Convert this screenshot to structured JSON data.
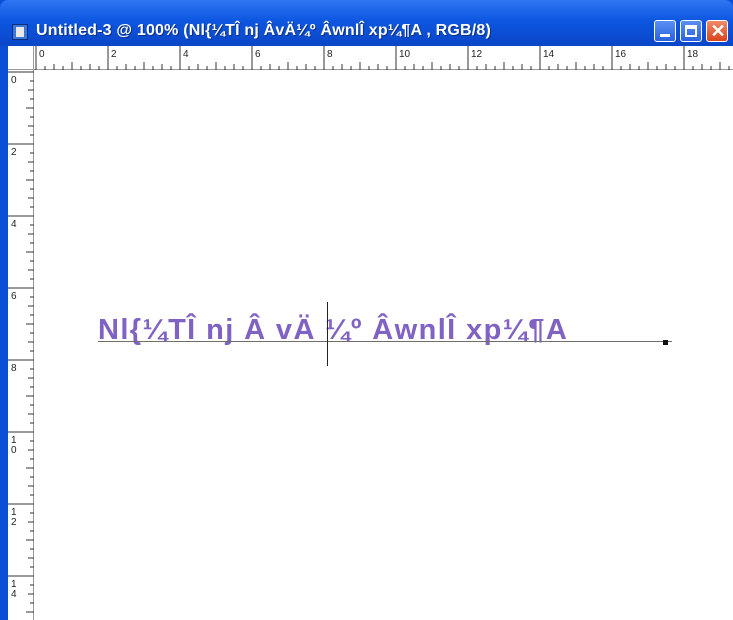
{
  "window": {
    "title": "Untitled-3 @ 100% (Nl{¼TÎ nj ÂvÄ¼º ÂwnlÎ xp¼¶A , RGB/8)",
    "title_color": "#0a4fd6",
    "buttons": {
      "minimize": "minimize",
      "maximize": "maximize",
      "close": "close"
    }
  },
  "rulers": {
    "horizontal_labels": [
      "0",
      "2",
      "4",
      "6",
      "8",
      "10",
      "12",
      "14",
      "16",
      "18"
    ],
    "vertical_labels": [
      "0",
      "2",
      "4",
      "6",
      "8",
      "10",
      "12",
      "14"
    ]
  },
  "canvas": {
    "text_layer": "Nl{¼TÎ nj Â vÄ ¼º ÂwnlÎ xp¼¶A",
    "text_color": "#7f62c3"
  }
}
